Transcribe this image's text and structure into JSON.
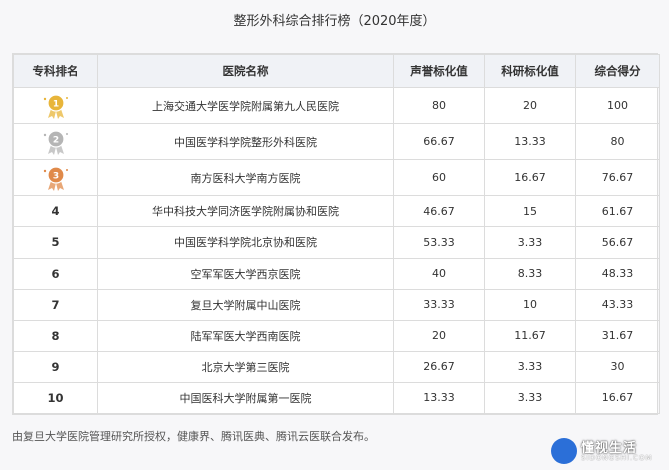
{
  "title": "整形外科综合排行榜（2020年度）",
  "table": {
    "headers": [
      "专科排名",
      "医院名称",
      "声誉标化值",
      "科研标化值",
      "综合得分"
    ],
    "rows": [
      {
        "rank": "1",
        "medal": "gold",
        "hospital": "上海交通大学医学院附属第九人民医院",
        "reputation": "80",
        "research": "20",
        "score": "100"
      },
      {
        "rank": "2",
        "medal": "silver",
        "hospital": "中国医学科学院整形外科医院",
        "reputation": "66.67",
        "research": "13.33",
        "score": "80"
      },
      {
        "rank": "3",
        "medal": "bronze",
        "hospital": "南方医科大学南方医院",
        "reputation": "60",
        "research": "16.67",
        "score": "76.67"
      },
      {
        "rank": "4",
        "medal": "",
        "hospital": "华中科技大学同济医学院附属协和医院",
        "reputation": "46.67",
        "research": "15",
        "score": "61.67"
      },
      {
        "rank": "5",
        "medal": "",
        "hospital": "中国医学科学院北京协和医院",
        "reputation": "53.33",
        "research": "3.33",
        "score": "56.67"
      },
      {
        "rank": "6",
        "medal": "",
        "hospital": "空军军医大学西京医院",
        "reputation": "40",
        "research": "8.33",
        "score": "48.33"
      },
      {
        "rank": "7",
        "medal": "",
        "hospital": "复旦大学附属中山医院",
        "reputation": "33.33",
        "research": "10",
        "score": "43.33"
      },
      {
        "rank": "8",
        "medal": "",
        "hospital": "陆军军医大学西南医院",
        "reputation": "20",
        "research": "11.67",
        "score": "31.67"
      },
      {
        "rank": "9",
        "medal": "",
        "hospital": "北京大学第三医院",
        "reputation": "26.67",
        "research": "3.33",
        "score": "30"
      },
      {
        "rank": "10",
        "medal": "",
        "hospital": "中国医科大学附属第一医院",
        "reputation": "13.33",
        "research": "3.33",
        "score": "16.67"
      }
    ]
  },
  "footer": "由复旦大学医院管理研究所授权，健康界、腾讯医典、腾讯云医联合发布。",
  "brand": {
    "name": "懂视生活",
    "sub": "SIDONGSHI.COM"
  },
  "colors": {
    "gold": "#e8b53a",
    "silver": "#b5b5b5",
    "bronze": "#e08a4a",
    "header_bg": "#f0f2f6",
    "border": "#dcdcdc"
  }
}
